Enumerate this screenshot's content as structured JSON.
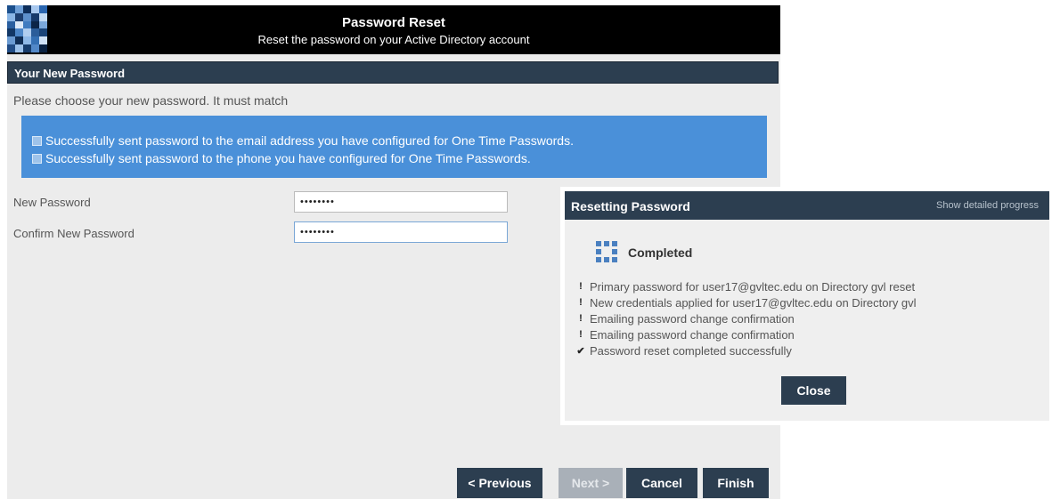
{
  "header": {
    "title": "Password Reset",
    "subtitle": "Reset the password on your Active Directory account"
  },
  "section": {
    "title": "Your New Password",
    "intro": "Please choose your new password. It must match"
  },
  "messages": [
    "Successfully sent password to the email address you have configured for One Time Passwords.",
    "Successfully sent password to the phone you have configured for One Time Passwords."
  ],
  "form": {
    "new_password_label": "New Password",
    "new_password_value": "••••••••",
    "confirm_password_label": "Confirm New Password",
    "confirm_password_value": "••••••••"
  },
  "buttons": {
    "previous": "< Previous",
    "next": "Next >",
    "cancel": "Cancel",
    "finish": "Finish"
  },
  "dialog": {
    "title": "Resetting Password",
    "detail_link": "Show detailed progress",
    "status": "Completed",
    "steps": [
      {
        "icon": "!",
        "text": "Primary password for  user17@gvltec.edu on Directory gvl reset"
      },
      {
        "icon": "!",
        "text": "New credentials applied for  user17@gvltec.edu on Directory gvl"
      },
      {
        "icon": "!",
        "text": "Emailing password change confirmation"
      },
      {
        "icon": "!",
        "text": "Emailing password change confirmation"
      },
      {
        "icon": "✔",
        "text": "Password reset completed successfully"
      }
    ],
    "close": "Close"
  },
  "colors": {
    "header_bg": "#000000",
    "bar_bg": "#2c3e50",
    "info_bg": "#4a90d9",
    "page_bg": "#ececec",
    "disabled_btn": "#a9b0b8"
  }
}
